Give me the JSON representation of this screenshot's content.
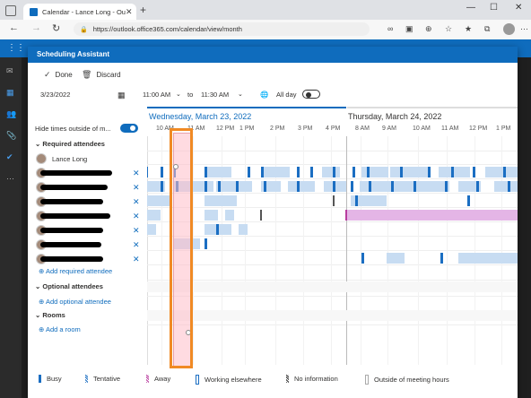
{
  "browser": {
    "tab_title": "Calendar - Lance Long - Outlook",
    "tab_close": "✕",
    "new_tab": "+",
    "url": "https://outlook.office365.com/calendar/view/month"
  },
  "dialog": {
    "title": "Scheduling Assistant",
    "done_label": "Done",
    "discard_label": "Discard",
    "date": "3/23/2022",
    "start_time": "11:00 AM",
    "to_label": "to",
    "end_time": "11:30 AM",
    "allday_label": "All day",
    "hide_times_label": "Hide times outside of m...",
    "day1": "Wednesday, March 23, 2022",
    "day2": "Thursday, March 24, 2022",
    "required_label": "Required attendees",
    "organizer": "Lance Long",
    "add_required": "Add required attendee",
    "optional_label": "Optional attendees",
    "add_optional": "Add optional attendee",
    "rooms_label": "Rooms",
    "add_room": "Add a room"
  },
  "hours": [
    "10 AM",
    "11 AM",
    "12 PM",
    "1 PM",
    "2 PM",
    "3 PM",
    "4 PM",
    "8 AM",
    "9 AM",
    "10 AM",
    "11 AM",
    "12 PM",
    "1 PM"
  ],
  "legend": {
    "busy": "Busy",
    "tentative": "Tentative",
    "away": "Away",
    "working_elsewhere": "Working elsewhere",
    "no_information": "No information",
    "outside": "Outside of meeting hours"
  },
  "colors": {
    "accent": "#0f6cbd",
    "busy": "#1b6ec2",
    "free_block": "#c7dcf2",
    "away": "#e4b5e6",
    "highlight": "#f08a24"
  }
}
